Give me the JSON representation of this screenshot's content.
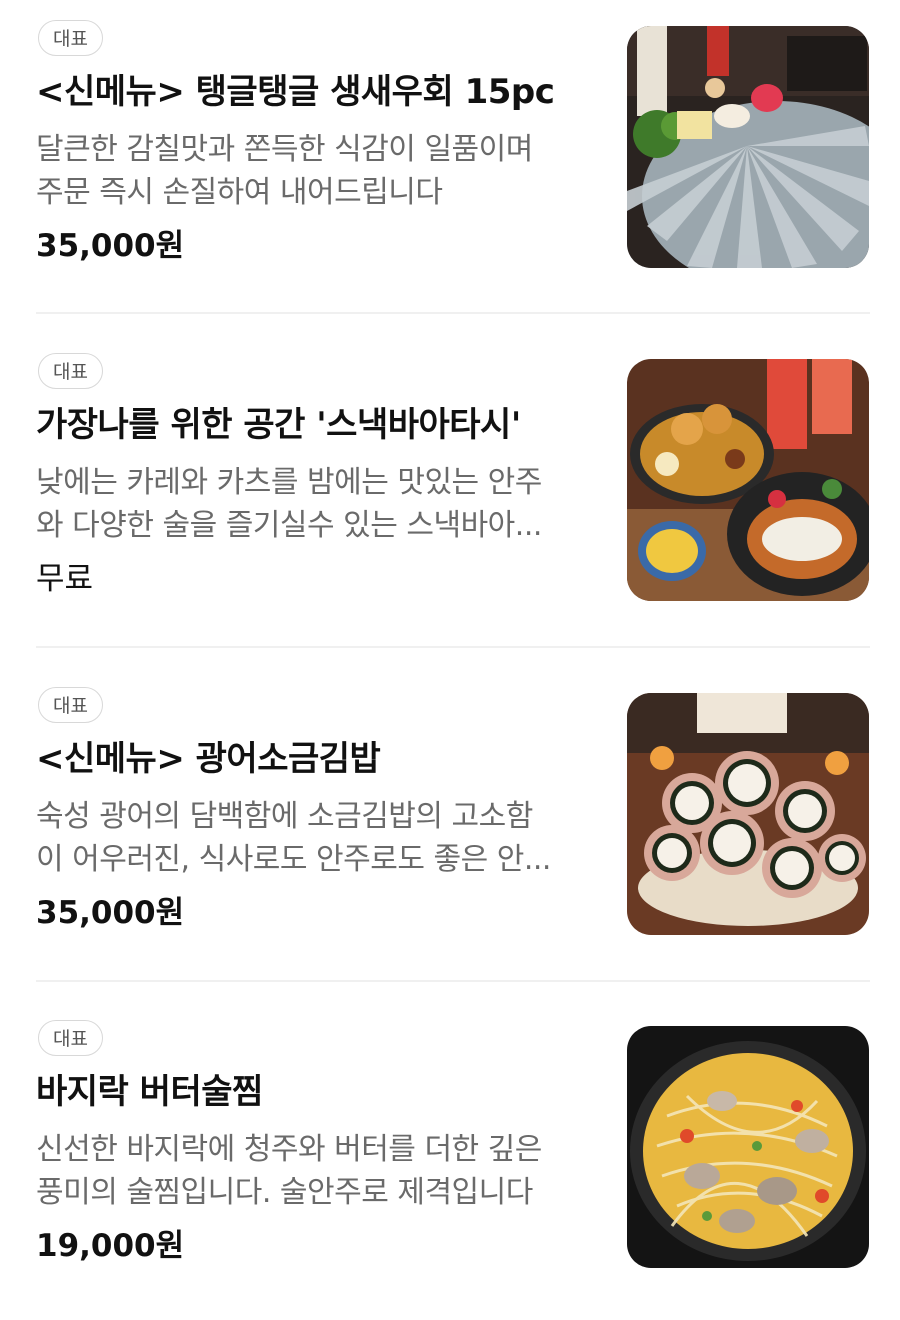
{
  "menu_items": [
    {
      "badge": "대표",
      "title": "<신메뉴> 탱글탱글 생새우회 15pc",
      "description_lines": [
        "달큰한 감칠맛과 쫀득한 식감이 일품이며",
        "주문 즉시 손질하여 내어드립니다"
      ],
      "price": "35,000원"
    },
    {
      "badge": "대표",
      "title": "가장나를 위한 공간 '스낵바아타시'",
      "description_lines": [
        "낮에는 카레와 카츠를 밤에는 맛있는 안주",
        "와 다양한 술을 즐기실수 있는 스낵바아..."
      ],
      "price": "무료"
    },
    {
      "badge": "대표",
      "title": "<신메뉴> 광어소금김밥",
      "description_lines": [
        "숙성 광어의 담백함에 소금김밥의 고소함",
        "이 어우러진, 식사로도 안주로도 좋은 안..."
      ],
      "price": "35,000원"
    },
    {
      "badge": "대표",
      "title": "바지락 버터술찜",
      "description_lines": [
        "신선한 바지락에 청주와 버터를 더한 깊은",
        "풍미의 술찜입니다. 술안주로 제격입니다"
      ],
      "price": "19,000원"
    }
  ]
}
